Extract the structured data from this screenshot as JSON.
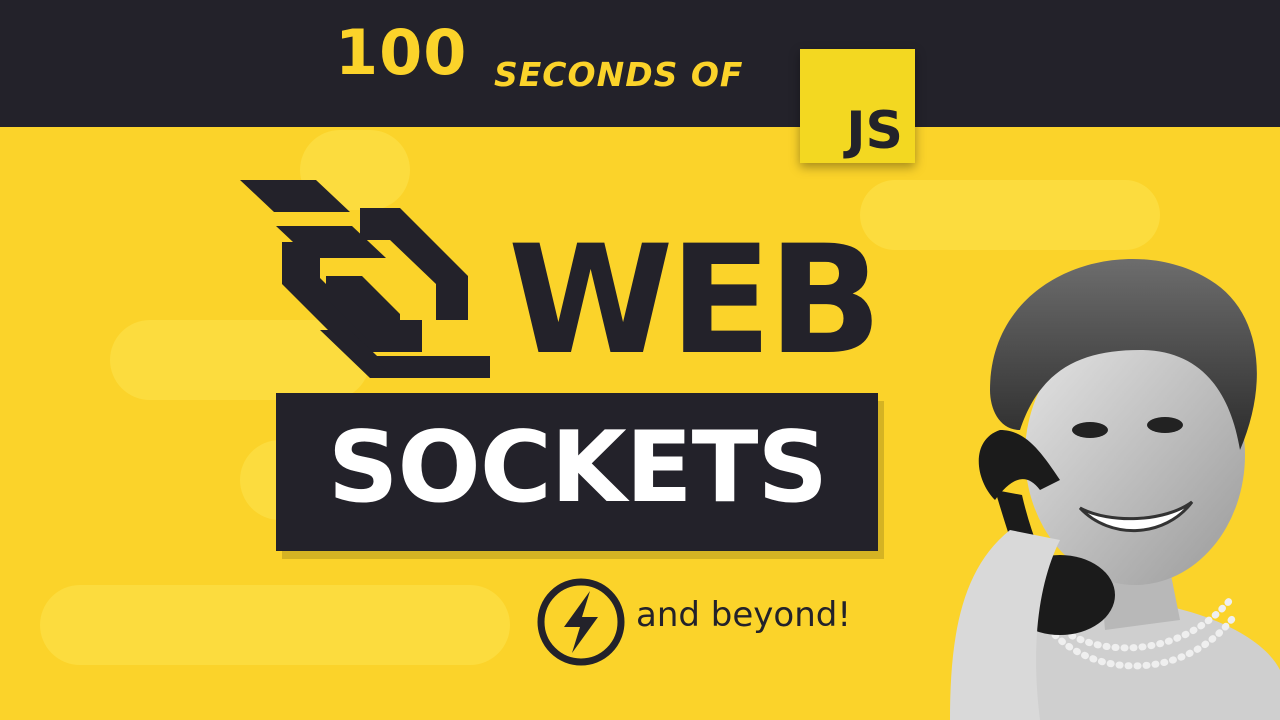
{
  "banner": {
    "series_number": "100",
    "series_text": "SECONDS OF",
    "badge_text": "JS"
  },
  "title": {
    "line1": "WEB",
    "line2": "SOCKETS"
  },
  "tagline": "and beyond!",
  "icons": {
    "websocket_logo": "websocket-logo-icon",
    "socketio_logo": "socketio-icon"
  },
  "colors": {
    "background": "#fbd32a",
    "dark": "#23222a",
    "badge": "#f3d821",
    "white": "#ffffff"
  }
}
